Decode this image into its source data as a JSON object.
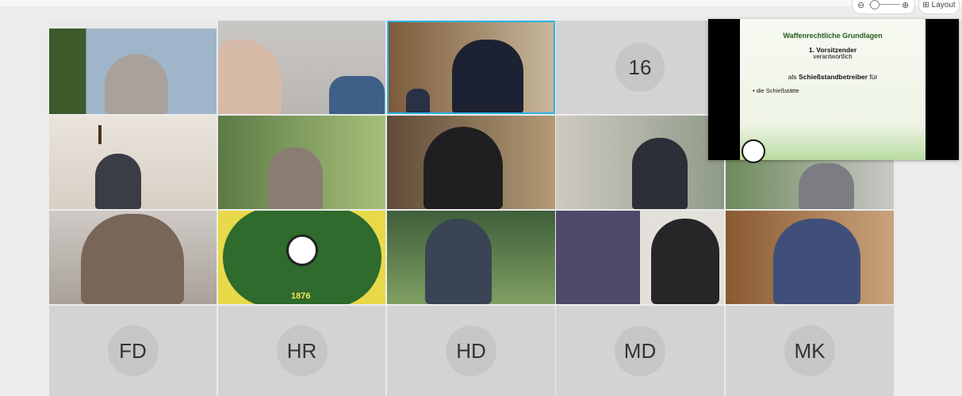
{
  "toolbar": {
    "zoom_out_icon": "zoom-out-icon",
    "zoom_in_icon": "zoom-in-icon",
    "layout_label": "Layout"
  },
  "grid": {
    "hidden_count": "16",
    "avatars": [
      "FD",
      "HR",
      "HD",
      "MD",
      "MK"
    ]
  },
  "share": {
    "title": "Waffenrechtliche Grundlagen",
    "sub1": "1. Vorsitzender",
    "sub2": "verantwortlich",
    "line_prefix": "als ",
    "line_bold": "Schießstandbetreiber",
    "line_suffix": " für",
    "bullet": "• die Schießstätte"
  },
  "club_logo_year": "1876",
  "colors": {
    "active_border": "#2bb3e8",
    "avatar_tile": "#d3d3d3"
  }
}
